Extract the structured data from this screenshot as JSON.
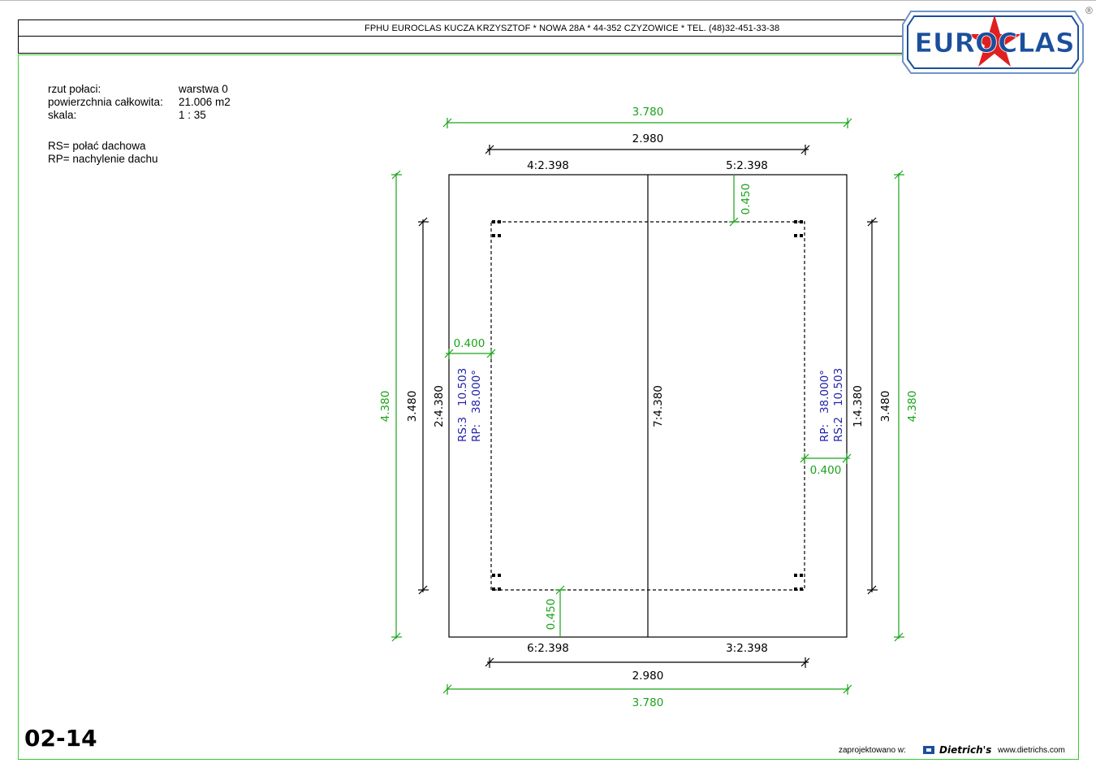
{
  "header": {
    "company_line": "FPHU EUROCLAS KUCZA KRZYSZTOF * NOWA 28A * 44-352 CZYZOWICE * TEL. (48)32-451-33-38",
    "logo_text": "EUROCLAS",
    "registered_mark": "®"
  },
  "info": {
    "rows": [
      {
        "label": "rzut połaci:",
        "value": "warstwa 0"
      },
      {
        "label": "powierzchnia całkowita:",
        "value": "21.006 m2"
      },
      {
        "label": "skala:",
        "value": "1 : 35"
      }
    ],
    "legend": [
      "RS= połać dachowa",
      "RP= nachylenie dachu"
    ]
  },
  "drawing": {
    "top_outer": "3.780",
    "top_inner": "2.980",
    "top_left_edge": "4:2.398",
    "top_right_edge": "5:2.398",
    "top_offset": "0.450",
    "bottom_left_edge": "6:2.398",
    "bottom_right_edge": "3:2.398",
    "bottom_inner": "2.980",
    "bottom_outer": "3.780",
    "bottom_offset": "0.450",
    "left_outer": "4.380",
    "left_inner": "3.480",
    "left_edge": "2:4.380",
    "left_offset": "0.400",
    "right_outer": "4.380",
    "right_inner": "3.480",
    "right_edge": "1:4.380",
    "right_offset": "0.400",
    "ridge": "7:4.380",
    "left_rs": "RS:3   10.503",
    "left_rp": "RP:   38.000°",
    "right_rp": "RP:   38.000°",
    "right_rs": "RS:2   10.503"
  },
  "footer": {
    "sheet_number": "02-14",
    "designed_in": "zaprojektowano w:",
    "brand": "Dietrich's",
    "website": "www.dietrichs.com"
  },
  "colors": {
    "frame_green": "#33cc33",
    "dimension_green": "#1aa31a",
    "label_blue": "#2222aa",
    "logo_blue": "#1b4f9c",
    "logo_red": "#e02020"
  }
}
